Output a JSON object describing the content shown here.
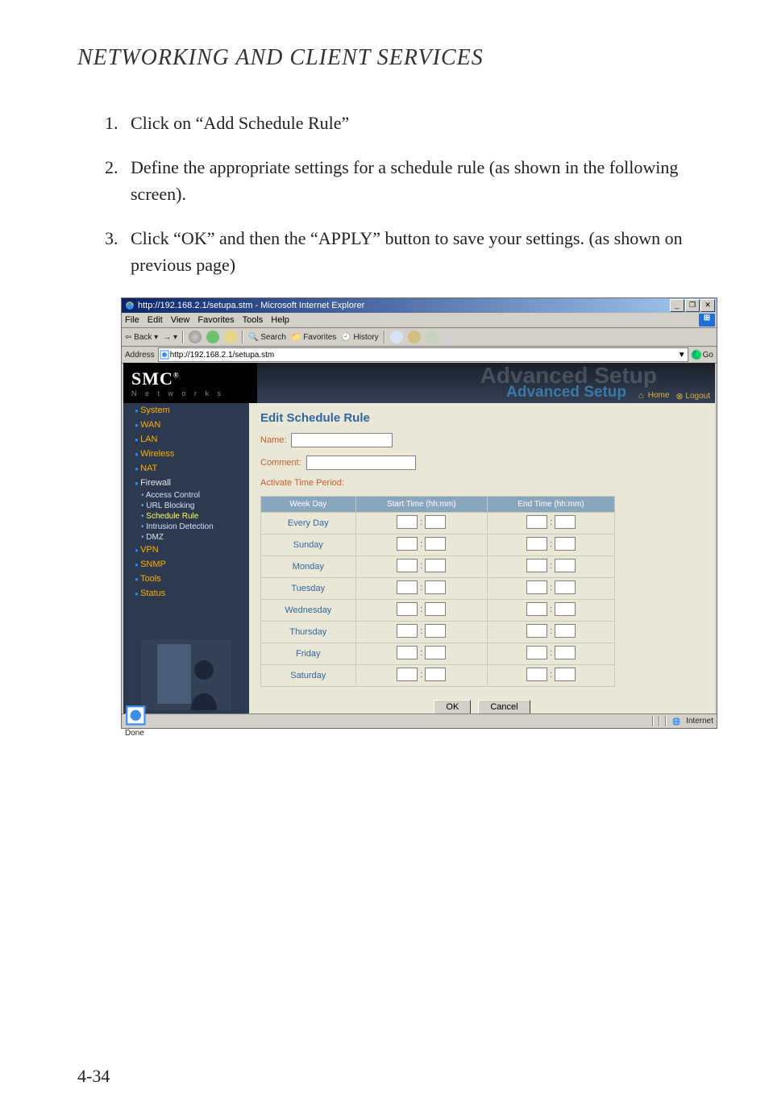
{
  "page": {
    "heading": "NETWORKING AND CLIENT SERVICES",
    "page_number": "4-34",
    "steps": [
      "Click on “Add Schedule Rule”",
      "Define the appropriate settings for a schedule rule (as shown in the following screen).",
      "Click “OK” and then the “APPLY” button to save your settings. (as shown on previous page)"
    ]
  },
  "ie": {
    "title": "http://192.168.2.1/setupa.stm - Microsoft Internet Explorer",
    "win_min": "_",
    "win_max": "❐",
    "win_close": "✕",
    "menus": [
      "File",
      "Edit",
      "View",
      "Favorites",
      "Tools",
      "Help"
    ],
    "toolbar": {
      "back": "Back",
      "search": "Search",
      "favorites": "Favorites",
      "history": "History"
    },
    "address_label": "Address",
    "address_value": "http://192.168.2.1/setupa.stm",
    "go_label": "Go",
    "status_left": "Done",
    "status_zone": "Internet"
  },
  "router": {
    "brand": "SMC",
    "brand_sup": "®",
    "brand_sub": "N e t w o r k s",
    "banner_watermark": "Advanced Setup",
    "banner_title": "Advanced Setup",
    "home": "Home",
    "logout": "Logout",
    "sidebar": {
      "system": "System",
      "wan": "WAN",
      "lan": "LAN",
      "wireless": "Wireless",
      "nat": "NAT",
      "firewall": "Firewall",
      "fw_access": "Access Control",
      "fw_url": "URL Blocking",
      "fw_sched": "Schedule Rule",
      "fw_idet": "Intrusion Detection",
      "fw_dmz": "DMZ",
      "vpn": "VPN",
      "snmp": "SNMP",
      "tools": "Tools",
      "status": "Status"
    },
    "main": {
      "title": "Edit Schedule Rule",
      "name_label": "Name:",
      "comment_label": "Comment:",
      "activate_label": "Activate Time Period:",
      "th_day": "Week Day",
      "th_start": "Start Time (hh:mm)",
      "th_end": "End Time (hh:mm)",
      "days": [
        "Every Day",
        "Sunday",
        "Monday",
        "Tuesday",
        "Wednesday",
        "Thursday",
        "Friday",
        "Saturday"
      ],
      "ok": "OK",
      "cancel": "Cancel"
    }
  }
}
